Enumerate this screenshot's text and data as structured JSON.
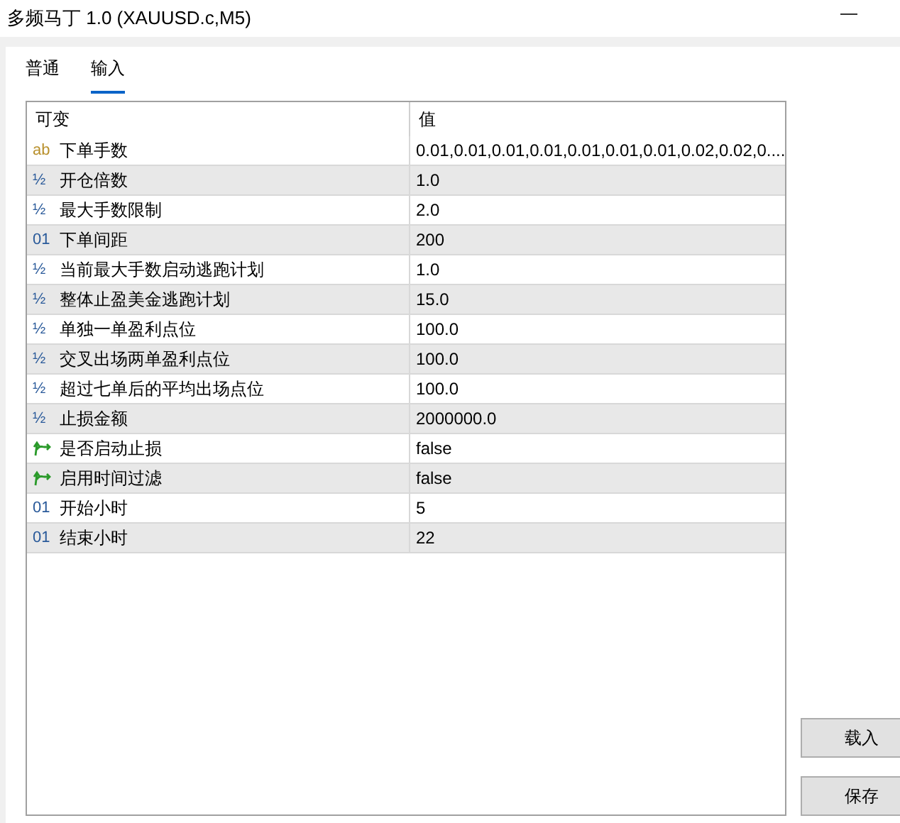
{
  "window": {
    "title": "多频马丁 1.0 (XAUUSD.c,M5)"
  },
  "tabs": [
    {
      "label": "普通",
      "selected": false
    },
    {
      "label": "输入",
      "selected": true
    }
  ],
  "table": {
    "columns": [
      "可变",
      "值"
    ],
    "rows": [
      {
        "kind": "text",
        "icon": "ab",
        "name": "下单手数",
        "value": "0.01,0.01,0.01,0.01,0.01,0.01,0.01,0.02,0.02,0...."
      },
      {
        "kind": "number",
        "icon": "½",
        "name": "开仓倍数",
        "value": "1.0"
      },
      {
        "kind": "number",
        "icon": "½",
        "name": "最大手数限制",
        "value": "2.0"
      },
      {
        "kind": "number",
        "icon": "01",
        "name": "下单间距",
        "value": "200"
      },
      {
        "kind": "number",
        "icon": "½",
        "name": "当前最大手数启动逃跑计划",
        "value": "1.0"
      },
      {
        "kind": "number",
        "icon": "½",
        "name": "整体止盈美金逃跑计划",
        "value": "15.0"
      },
      {
        "kind": "number",
        "icon": "½",
        "name": "单独一单盈利点位",
        "value": "100.0"
      },
      {
        "kind": "number",
        "icon": "½",
        "name": "交叉出场两单盈利点位",
        "value": "100.0"
      },
      {
        "kind": "number",
        "icon": "½",
        "name": "超过七单后的平均出场点位",
        "value": "100.0"
      },
      {
        "kind": "number",
        "icon": "½",
        "name": "止损金额",
        "value": "2000000.0"
      },
      {
        "kind": "bool",
        "name": "是否启动止损",
        "value": "false"
      },
      {
        "kind": "bool",
        "name": "启用时间过滤",
        "value": "false"
      },
      {
        "kind": "number",
        "icon": "01",
        "name": "开始小时",
        "value": "5"
      },
      {
        "kind": "number",
        "icon": "01",
        "name": "结束小时",
        "value": "22"
      }
    ]
  },
  "buttons": [
    "载入",
    "保存"
  ]
}
